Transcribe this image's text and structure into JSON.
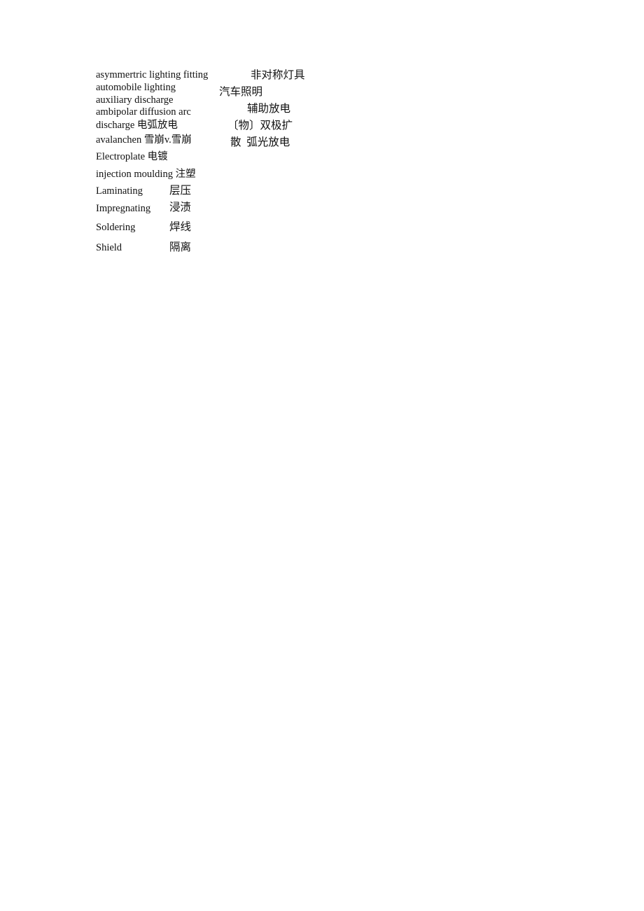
{
  "page": {
    "left_column": [
      "asymmertric lighting fitting",
      "automobile lighting",
      "auxiliary discharge",
      "ambipolar diffusion arc",
      "discharge 电弧放电",
      "avalanchen 雪崩v.雪崩"
    ],
    "right_column": [
      "非对称灯具",
      "汽车照明",
      "辅助放电",
      "〔物〕双极扩",
      "散  弧光放电"
    ],
    "rows": [
      {
        "term": "Electroplate 电镀"
      },
      {
        "term": "injection moulding 注塑"
      },
      {
        "term": "Laminating",
        "translation": "层压"
      },
      {
        "term": "Impregnating",
        "translation": "浸渍"
      },
      {
        "term": "Soldering",
        "translation": "焊线"
      },
      {
        "term": "Shield",
        "translation": "隔离"
      }
    ]
  }
}
